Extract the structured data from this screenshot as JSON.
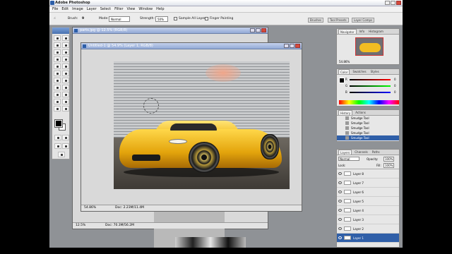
{
  "app": {
    "title": "Adobe Photoshop"
  },
  "menu": [
    "File",
    "Edit",
    "Image",
    "Layer",
    "Select",
    "Filter",
    "View",
    "Window",
    "Help"
  ],
  "options": {
    "brush_label": "Brush:",
    "brush_size": "9",
    "mode_label": "Mode:",
    "mode_value": "Normal",
    "strength_label": "Strength:",
    "strength_value": "50%",
    "sample_all_layers": "Sample All Layers",
    "finger_painting": "Finger Painting"
  },
  "wells": [
    "Brushes",
    "Tool Presets",
    "Layer Comps"
  ],
  "back_doc": {
    "title": "parts.jpg @ 12.5% (RGB/8)",
    "zoom": "12.5%",
    "doc_size": "Doc: 70.3M/56.2M"
  },
  "front_doc": {
    "title": "Untitled-1 @ 54.9% (Layer 1, RGB/8)",
    "zoom": "54.86%",
    "doc_size": "Doc: 2.23M/11.4M"
  },
  "navigator": {
    "tabs": [
      "Navigator",
      "Info",
      "Histogram"
    ],
    "zoom": "54.86%"
  },
  "color": {
    "tabs": [
      "Color",
      "Swatches",
      "Styles"
    ],
    "channels": [
      "R",
      "G",
      "B"
    ],
    "values": [
      "0",
      "0",
      "0"
    ]
  },
  "history": {
    "tabs": [
      "History",
      "Actions"
    ],
    "items": [
      "Smudge Tool",
      "Smudge Tool",
      "Smudge Tool",
      "Smudge Tool",
      "Smudge Tool"
    ]
  },
  "layers": {
    "tabs": [
      "Layers",
      "Channels",
      "Paths"
    ],
    "blend_mode": "Normal",
    "opacity_label": "Opacity:",
    "opacity": "100%",
    "lock_label": "Lock:",
    "fill_label": "Fill:",
    "fill": "100%",
    "items": [
      "Layer 8",
      "Layer 7",
      "Layer 6",
      "Layer 5",
      "Layer 4",
      "Layer 3",
      "Layer 2",
      "Layer 1"
    ]
  }
}
